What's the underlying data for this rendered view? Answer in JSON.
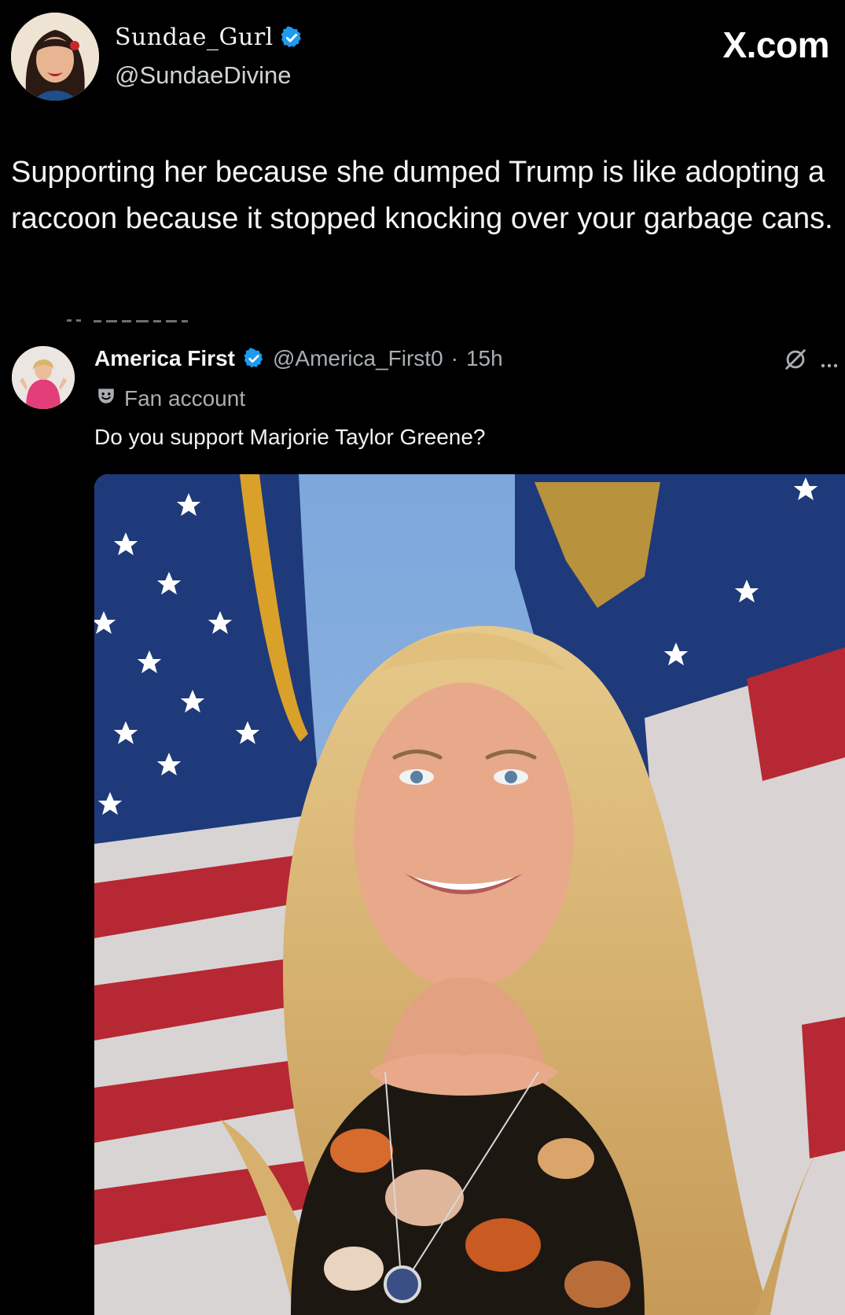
{
  "brand": "X.com",
  "author": {
    "display_name": "Sundae_Gurl",
    "handle": "@SundaeDivine",
    "avatar_icon": "profile-photo-icon",
    "verified_icon": "verified-badge-icon"
  },
  "tweet": {
    "text": "Supporting her because she dumped Trump is like adopting a raccoon because it stopped knocking over your garbage cans."
  },
  "quoted": {
    "display_name": "America First",
    "handle": "@America_First0",
    "separator": "·",
    "time": "15h",
    "label": "Fan account",
    "text": "Do you support Marjorie Taylor Greene?",
    "icons": [
      "grok-icon",
      "more-icon"
    ]
  },
  "colors": {
    "background": "#000000",
    "text": "#e7e9ea",
    "muted": "#a9aeb2",
    "verified": "#1d9bf0"
  }
}
